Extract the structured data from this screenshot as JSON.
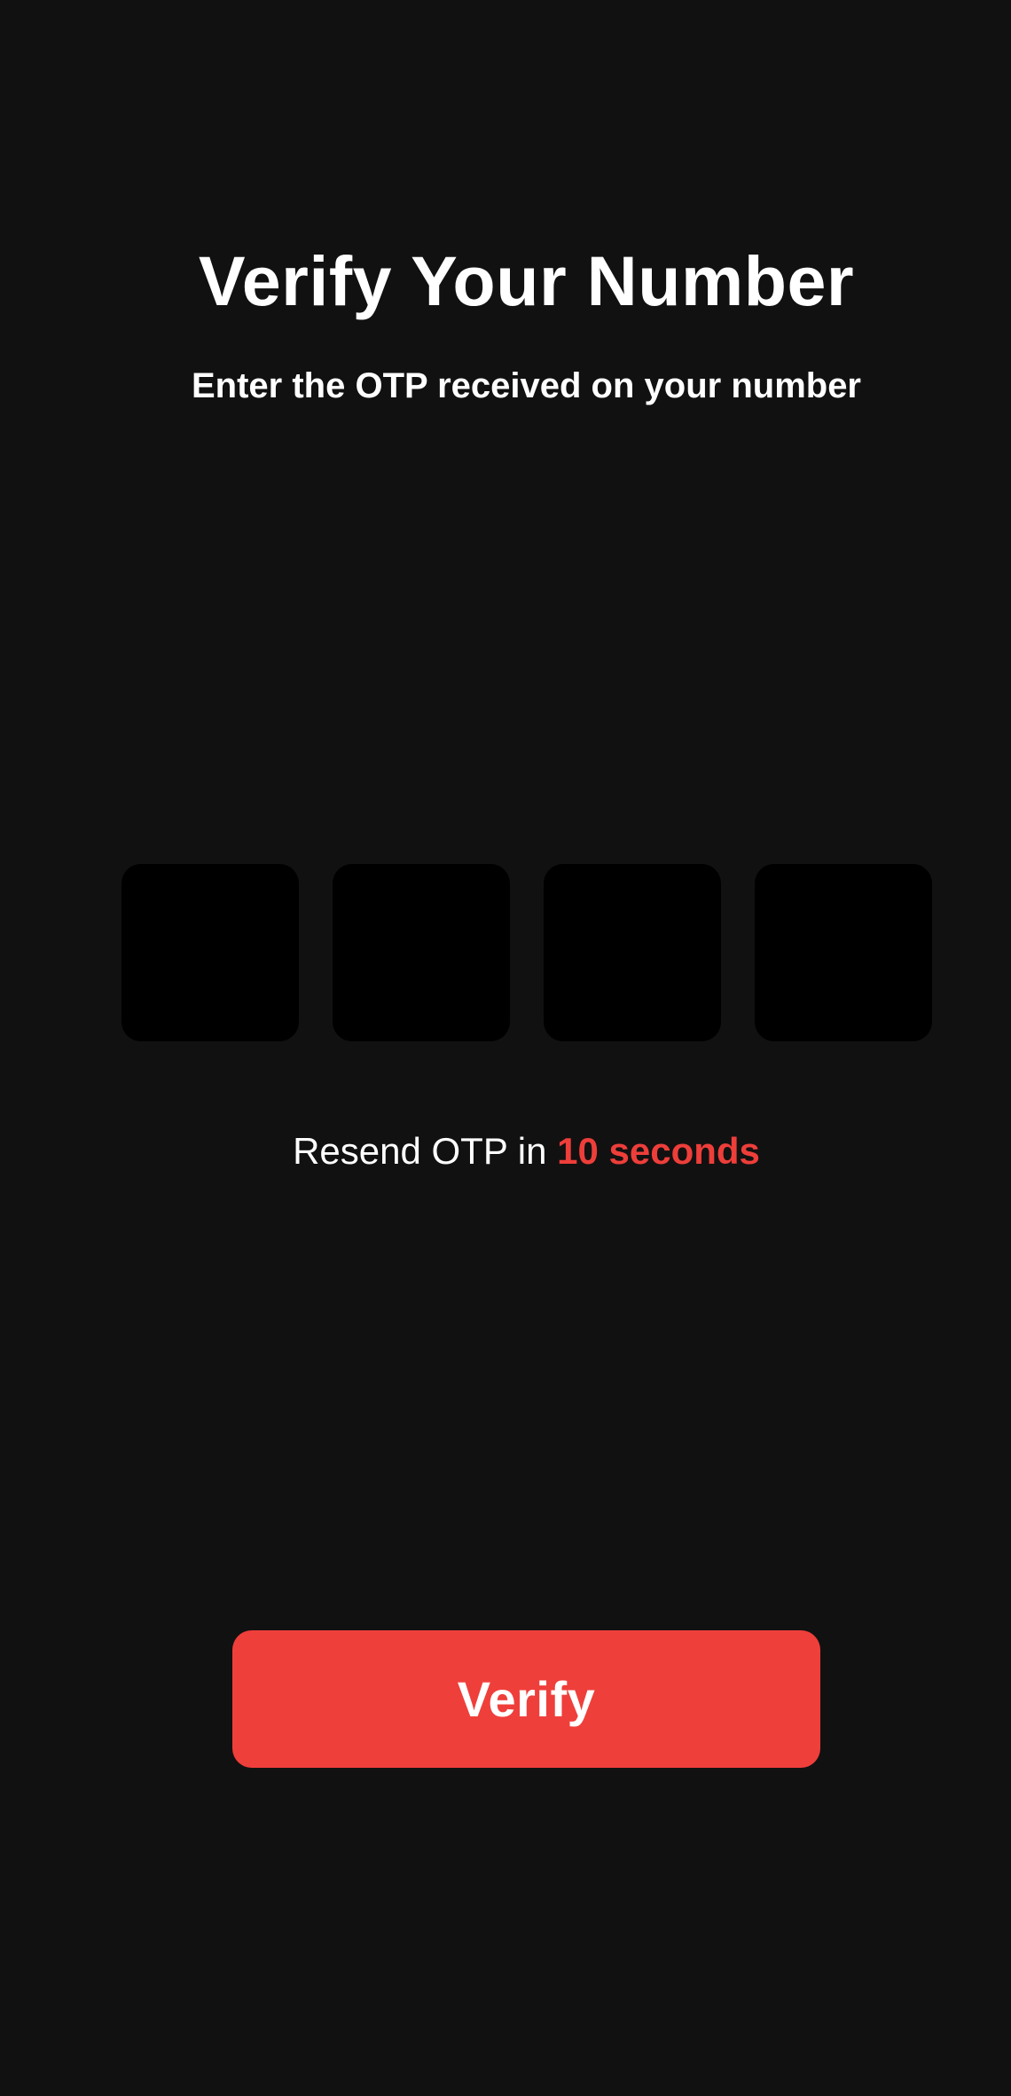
{
  "header": {
    "title": "Verify Your Number",
    "subtitle": "Enter the OTP received on your number"
  },
  "otp": {
    "digits": [
      "",
      "",
      "",
      ""
    ]
  },
  "resend": {
    "prefix": "Resend OTP in ",
    "countdown": "10 seconds"
  },
  "actions": {
    "verify_label": "Verify"
  },
  "colors": {
    "background": "#121111",
    "otp_box": "#000000",
    "accent": "#ef3f3b",
    "text": "#ffffff"
  }
}
